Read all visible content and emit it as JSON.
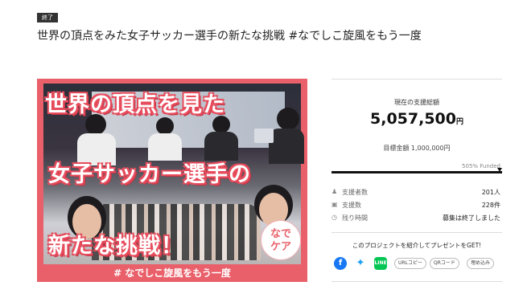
{
  "status_badge": "終了",
  "project_title": "世界の頂点をみた女子サッカー選手の新たな挑戦 #なでしこ旋風をもう一度",
  "hero": {
    "line1": "世界の頂点を見た",
    "line2": "女子サッカー選手の",
    "line3": "新たな挑戦！",
    "caption": "# なでしこ旋風をもう一度",
    "badge": "なで\nケア"
  },
  "funding": {
    "raised_label": "現在の支援総額",
    "raised_amount": "5,057,500",
    "raised_unit": "円",
    "goal_text": "目標金額 1,000,000円",
    "funded_text": "505% Funded",
    "progress_fraction": 1.0
  },
  "stats": [
    {
      "icon": "people-icon",
      "label": "支援者数",
      "value": "201人"
    },
    {
      "icon": "gift-icon",
      "label": "支援数",
      "value": "228件"
    },
    {
      "icon": "clock-icon",
      "label": "残り時間",
      "value": "募集は終了しました"
    }
  ],
  "share": {
    "title": "このプロジェクトを紹介してプレゼントをGET!",
    "buttons": [
      "URLコピー",
      "QRコード",
      "埋め込み"
    ],
    "colors": {
      "facebook": "#1877f2",
      "twitter": "#1da1f2",
      "line": "#06c755"
    }
  }
}
